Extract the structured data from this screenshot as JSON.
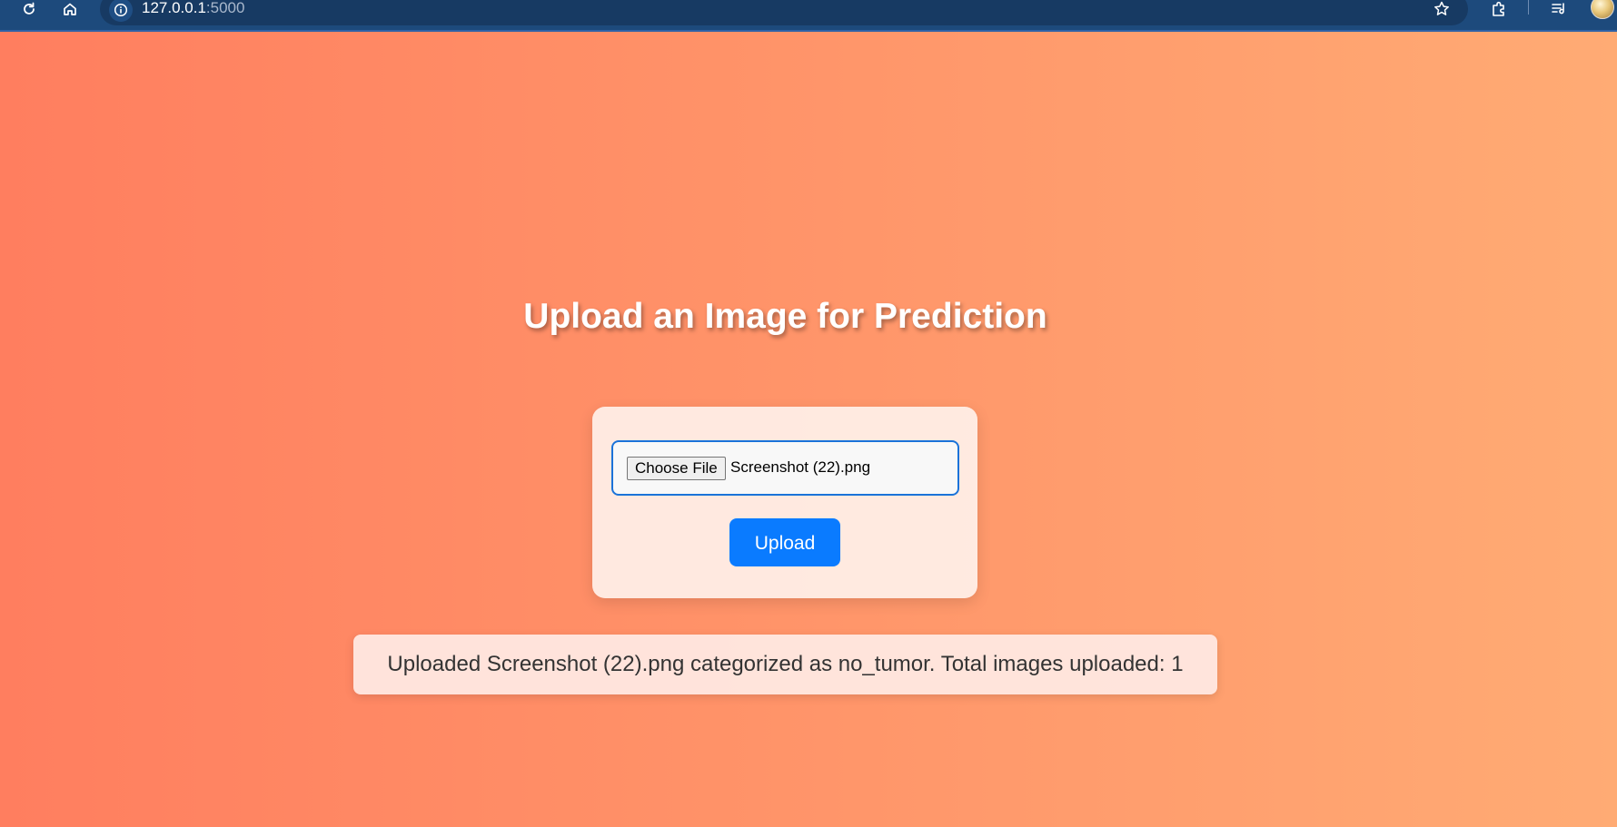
{
  "browser": {
    "url_host": "127.0.0.1",
    "url_port": ":5000",
    "icons": [
      "reload-icon",
      "home-icon",
      "site-info-icon",
      "bookmark-star-icon",
      "extensions-icon",
      "reading-list-icon",
      "profile-avatar"
    ]
  },
  "page": {
    "title": "Upload an Image for Prediction",
    "background_gradient": [
      "#ff7e5f",
      "#ffab74"
    ],
    "form": {
      "choose_file_label": "Choose File",
      "selected_file": "Screenshot (22).png",
      "upload_label": "Upload",
      "upload_color": "#0a7bff",
      "input_border_color": "#1a73d9"
    },
    "result_message": "Uploaded Screenshot (22).png categorized as no_tumor. Total images uploaded: 1"
  }
}
